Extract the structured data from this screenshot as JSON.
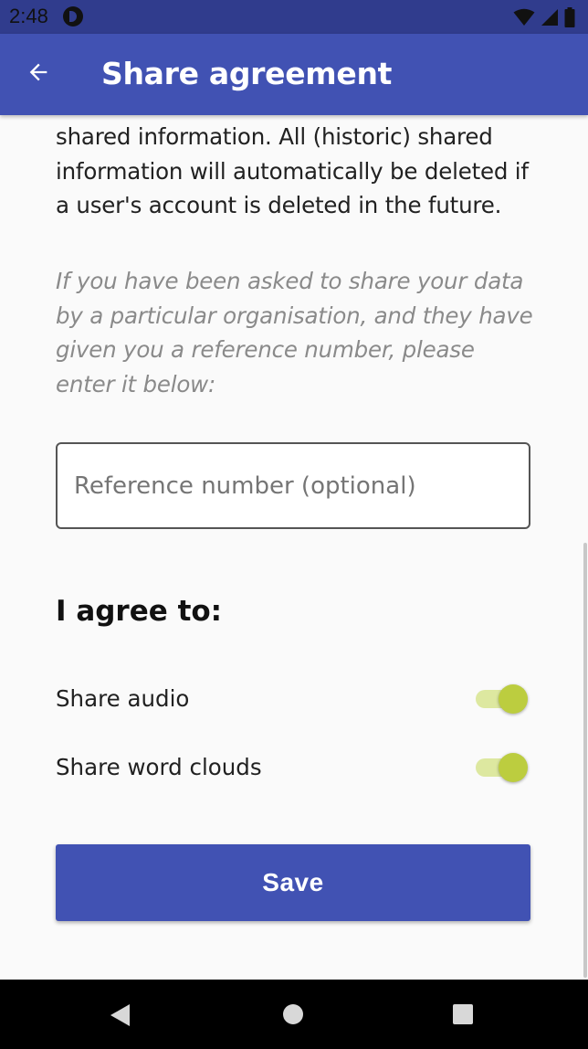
{
  "status_bar": {
    "time": "2:48",
    "icons": [
      "app-notification-icon",
      "wifi-icon",
      "signal-icon",
      "battery-icon"
    ]
  },
  "app_bar": {
    "title": "Share agreement",
    "back_icon": "arrow-back-icon"
  },
  "content": {
    "body_text": "shared information. All (historic) shared information will automatically be deleted if a user's account is deleted in the future.",
    "hint_text": "If you have been asked to share your data by a particular organisation, and they have given you a reference number, please enter it below:",
    "reference_input": {
      "value": "",
      "placeholder": "Reference number (optional)"
    },
    "agree_heading": "I agree to:",
    "toggles": [
      {
        "label": "Share audio",
        "checked": true
      },
      {
        "label": "Share word clouds",
        "checked": true
      }
    ],
    "save_label": "Save"
  },
  "nav_bar": {
    "icons": [
      "nav-back-icon",
      "nav-home-icon",
      "nav-recents-icon"
    ]
  },
  "colors": {
    "primary": "#4152b3",
    "status_bar": "#303c8d",
    "toggle_thumb": "#bccd3f",
    "toggle_track": "#dde8a0"
  }
}
